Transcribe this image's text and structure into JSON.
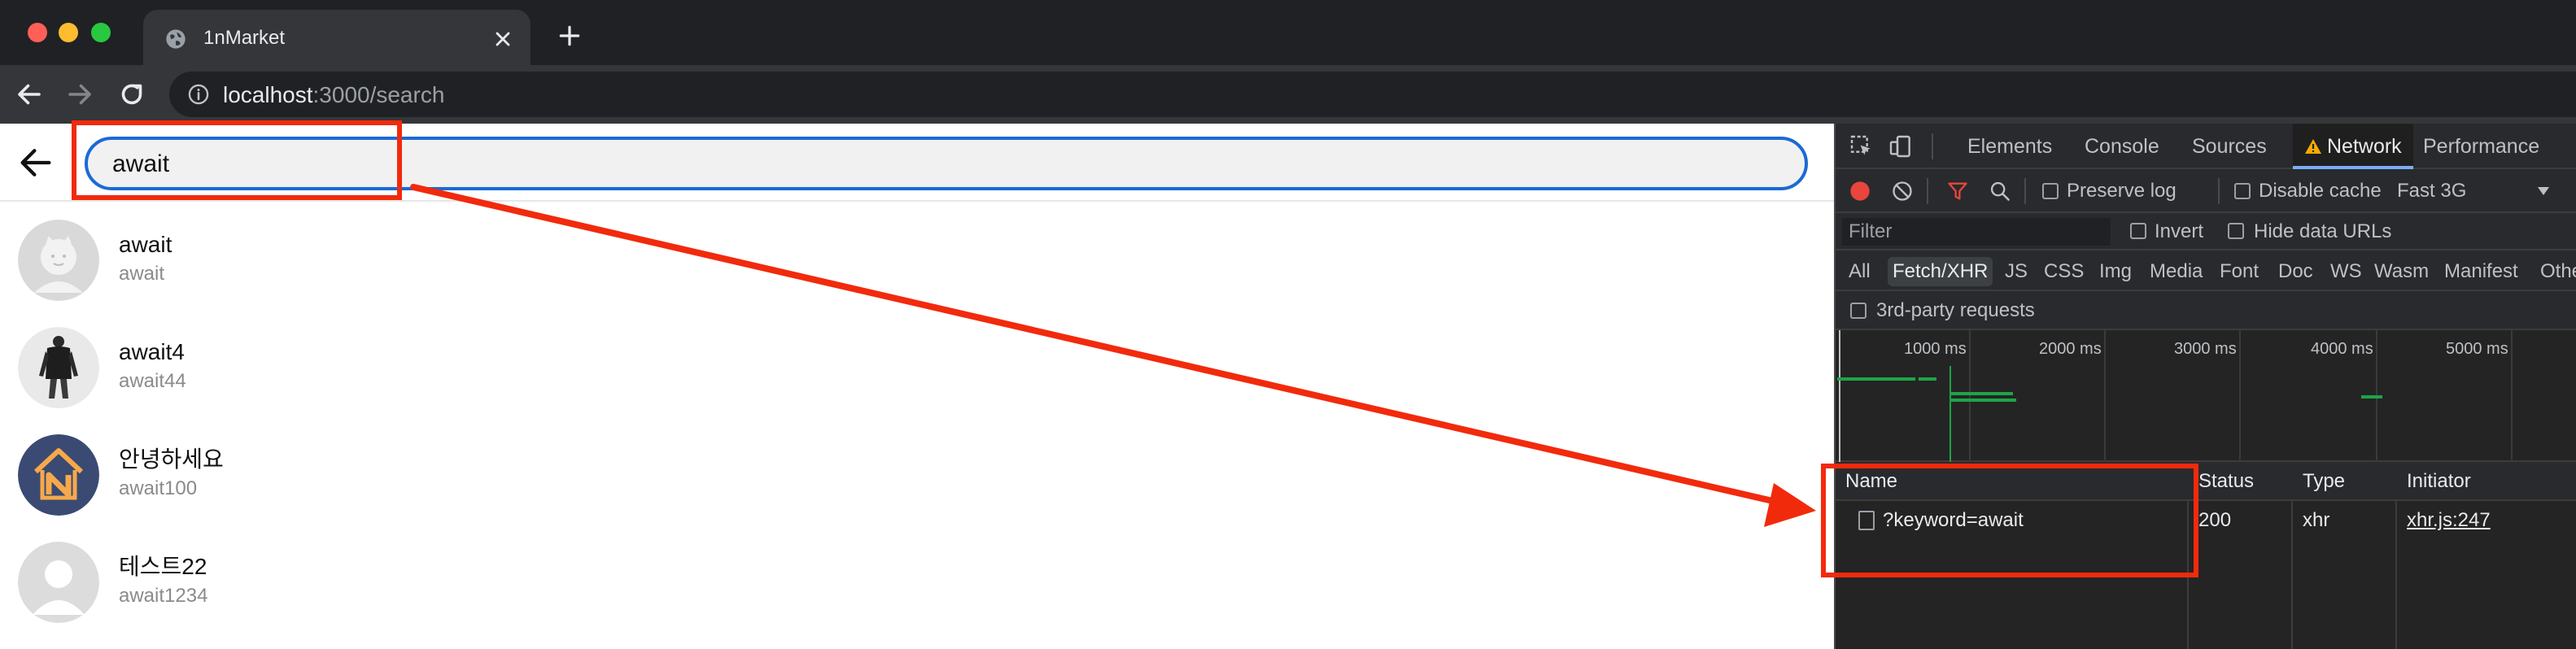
{
  "browser": {
    "tab_title": "1nMarket",
    "url_host": "localhost",
    "url_rest": ":3000/search"
  },
  "search": {
    "query": "await"
  },
  "results": [
    {
      "name": "await",
      "handle": "await",
      "avatar": "default-cat-avatar"
    },
    {
      "name": "await4",
      "handle": "await44",
      "avatar": "fashion-photo-avatar"
    },
    {
      "name": "안녕하세요",
      "handle": "await100",
      "avatar": "house-logo-avatar"
    },
    {
      "name": "테스트22",
      "handle": "await1234",
      "avatar": "default-person-avatar"
    }
  ],
  "devtools": {
    "tabs": [
      "Elements",
      "Console",
      "Sources",
      "Network",
      "Performance"
    ],
    "active_tab": "Network",
    "preserve_log": "Preserve log",
    "disable_cache": "Disable cache",
    "throttling": "Fast 3G",
    "filter_placeholder": "Filter",
    "invert": "Invert",
    "hide_data_urls": "Hide data URLs",
    "types": [
      "All",
      "Fetch/XHR",
      "JS",
      "CSS",
      "Img",
      "Media",
      "Font",
      "Doc",
      "WS",
      "Wasm",
      "Manifest",
      "Othe"
    ],
    "active_type": "Fetch/XHR",
    "third_party": "3rd-party requests",
    "timeline_labels": [
      "1000 ms",
      "2000 ms",
      "3000 ms",
      "4000 ms",
      "5000 ms"
    ],
    "columns": [
      "Name",
      "Status",
      "Type",
      "Initiator"
    ],
    "requests": [
      {
        "name": "?keyword=await",
        "status": "200",
        "type": "xhr",
        "initiator": "xhr.js:247"
      }
    ]
  },
  "colors": {
    "annotation": "#f22a0c",
    "search_focus": "#1a6ad6",
    "recording": "#e8453c",
    "timeline_bar": "#1ea446"
  }
}
